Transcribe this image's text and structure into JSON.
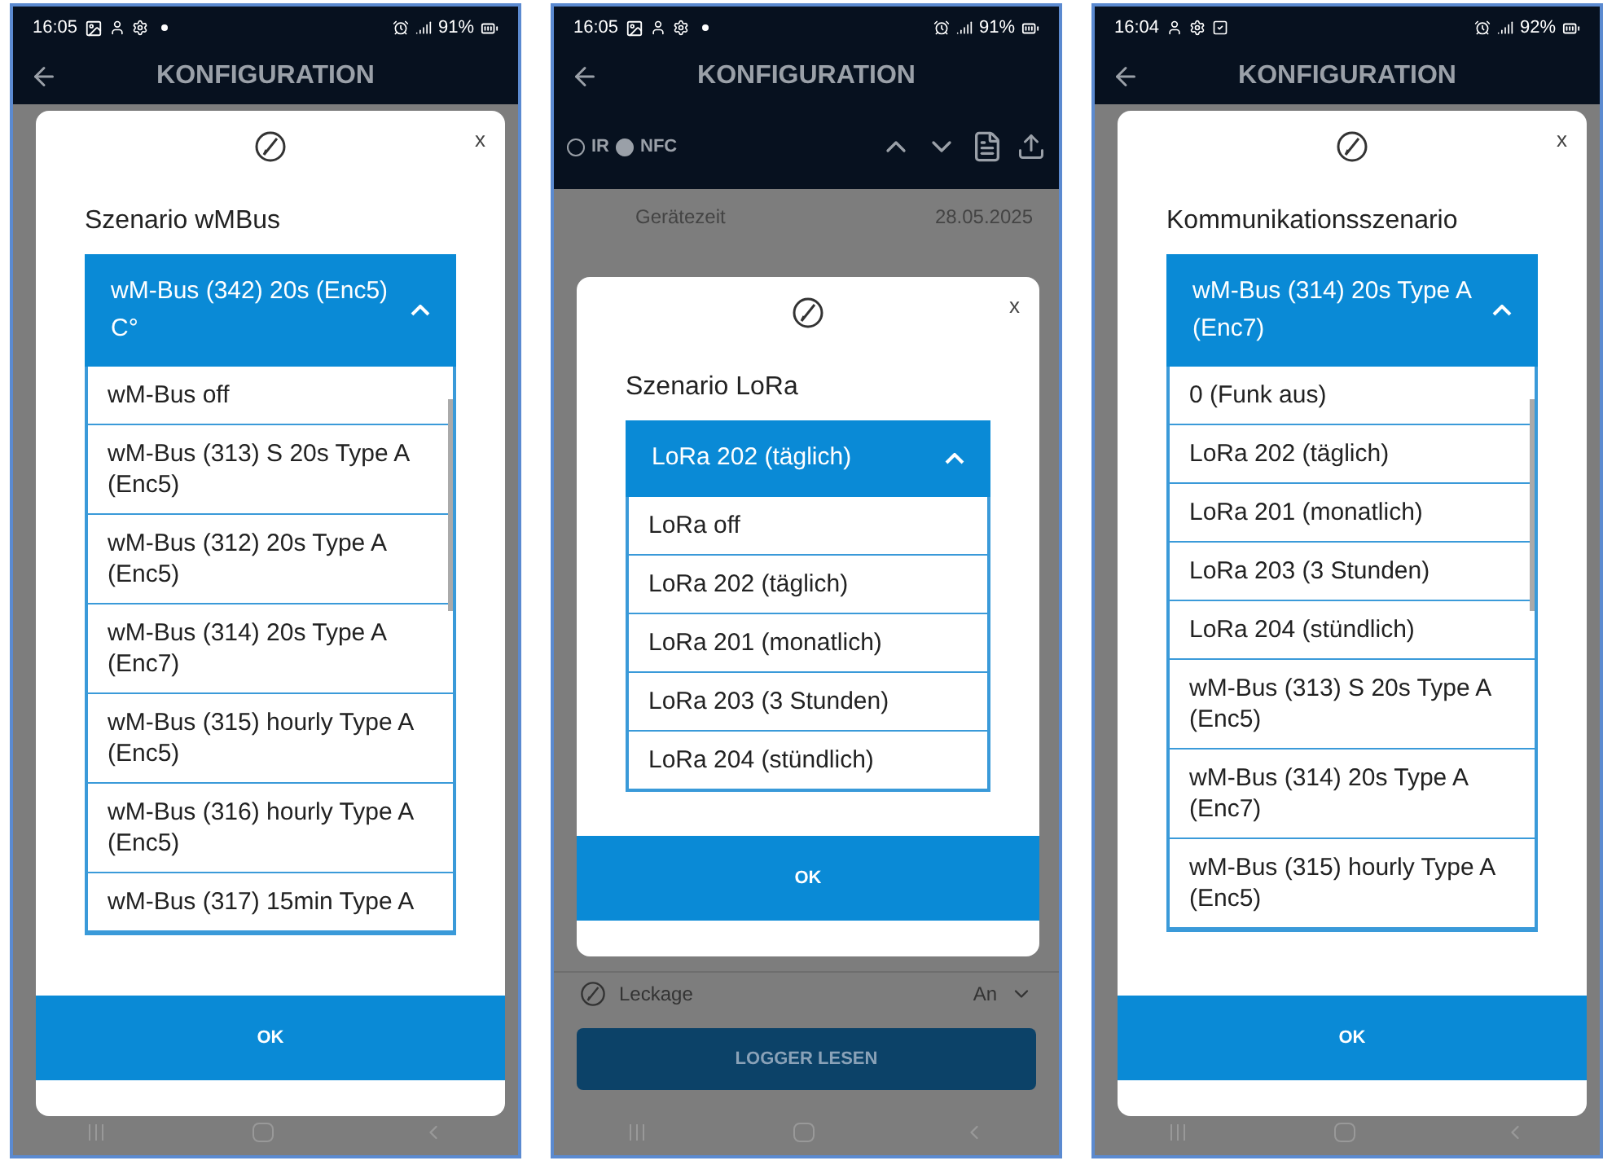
{
  "phones": [
    {
      "status_bar": {
        "time": "16:05",
        "battery": "91%"
      },
      "header": {
        "title": "KONFIGURATION"
      },
      "dialog": {
        "close": "x",
        "title": "Szenario wMBus",
        "selected_value": "wM-Bus (342) 20s (Enc5) C°",
        "scrollable": true,
        "options": [
          "wM-Bus off",
          "wM-Bus (313) S 20s Type A (Enc5)",
          "wM-Bus (312) 20s Type A (Enc5)",
          "wM-Bus (314) 20s Type A (Enc7)",
          "wM-Bus (315) hourly Type A (Enc5)",
          "wM-Bus (316) hourly Type A (Enc5)",
          "wM-Bus (317) 15min Type A"
        ],
        "ok": "OK"
      }
    },
    {
      "status_bar": {
        "time": "16:05",
        "battery": "91%"
      },
      "header": {
        "title": "KONFIGURATION"
      },
      "toolbar": {
        "radios": [
          {
            "label": "IR",
            "selected": false
          },
          {
            "label": "NFC",
            "selected": true
          }
        ]
      },
      "rows_top": [
        {
          "label": "Gerätezeit",
          "value": "28.05.2025"
        }
      ],
      "rows_bottom": [
        {
          "label": "Leckage",
          "value": "An"
        }
      ],
      "action_button": "LOGGER LESEN",
      "dialog": {
        "close": "x",
        "title": "Szenario LoRa",
        "selected_value": "LoRa 202 (täglich)",
        "scrollable": false,
        "options": [
          "LoRa off",
          "LoRa 202 (täglich)",
          "LoRa 201 (monatlich)",
          "LoRa 203 (3 Stunden)",
          "LoRa 204 (stündlich)"
        ],
        "ok": "OK"
      }
    },
    {
      "status_bar": {
        "time": "16:04",
        "battery": "92%"
      },
      "header": {
        "title": "KONFIGURATION"
      },
      "dialog": {
        "close": "x",
        "title": "Kommunikationsszenario",
        "selected_value": "wM-Bus (314) 20s Type A (Enc7)",
        "scrollable": true,
        "options": [
          "0 (Funk aus)",
          "LoRa 202 (täglich)",
          "LoRa 201 (monatlich)",
          "LoRa 203 (3 Stunden)",
          "LoRa 204 (stündlich)",
          "wM-Bus (313) S 20s Type A (Enc5)",
          "wM-Bus (314) 20s Type A (Enc7)",
          "wM-Bus (315) hourly Type A (Enc5)"
        ],
        "ok": "OK"
      }
    }
  ]
}
